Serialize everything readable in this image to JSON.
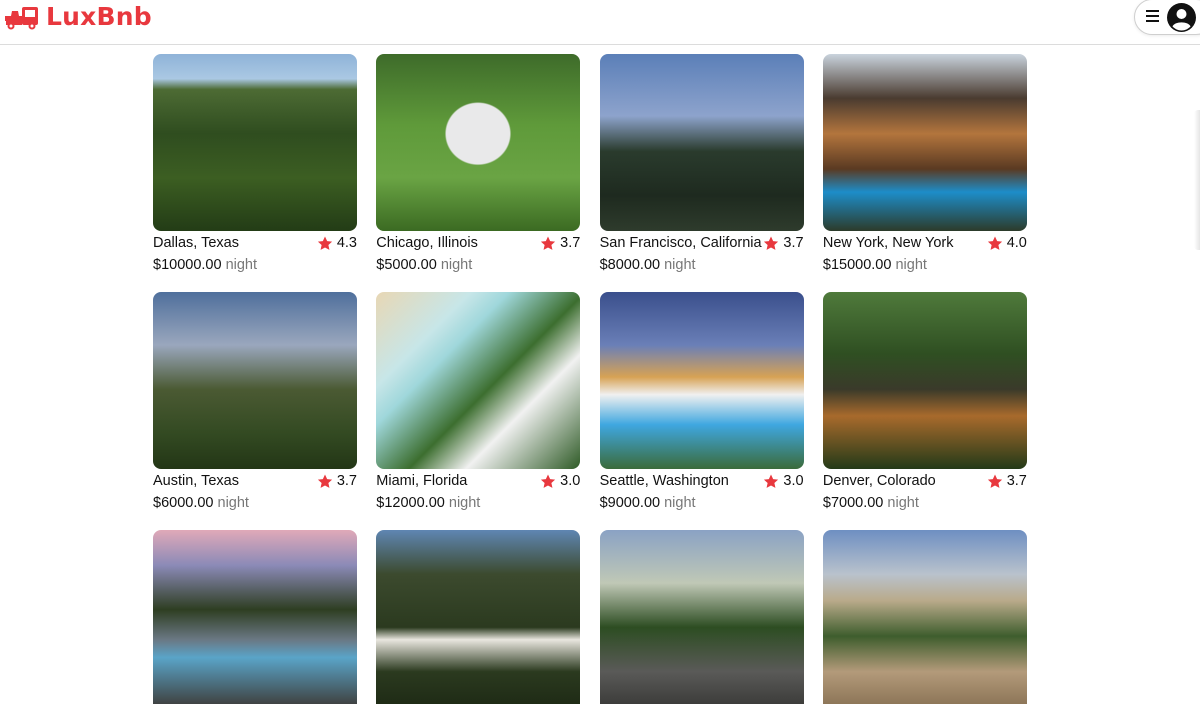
{
  "brand": {
    "name": "LuxBnb",
    "color": "#e8383e"
  },
  "header": {
    "menu_icon": "hamburger-icon",
    "avatar_icon": "avatar-icon"
  },
  "listings": [
    {
      "location": "Dallas, Texas",
      "rating": "4.3",
      "price": "$10000.00",
      "unit": "night"
    },
    {
      "location": "Chicago, Illinois",
      "rating": "3.7",
      "price": "$5000.00",
      "unit": "night"
    },
    {
      "location": "San Francisco, California",
      "rating": "3.7",
      "price": "$8000.00",
      "unit": "night"
    },
    {
      "location": "New York, New York",
      "rating": "4.0",
      "price": "$15000.00",
      "unit": "night"
    },
    {
      "location": "Austin, Texas",
      "rating": "3.7",
      "price": "$6000.00",
      "unit": "night"
    },
    {
      "location": "Miami, Florida",
      "rating": "3.0",
      "price": "$12000.00",
      "unit": "night"
    },
    {
      "location": "Seattle, Washington",
      "rating": "3.0",
      "price": "$9000.00",
      "unit": "night"
    },
    {
      "location": "Denver, Colorado",
      "rating": "3.7",
      "price": "$7000.00",
      "unit": "night"
    },
    {
      "location": "",
      "rating": "",
      "price": "",
      "unit": ""
    },
    {
      "location": "",
      "rating": "",
      "price": "",
      "unit": ""
    },
    {
      "location": "",
      "rating": "",
      "price": "",
      "unit": ""
    },
    {
      "location": "",
      "rating": "",
      "price": "",
      "unit": ""
    }
  ],
  "star_color": "#e8383e"
}
